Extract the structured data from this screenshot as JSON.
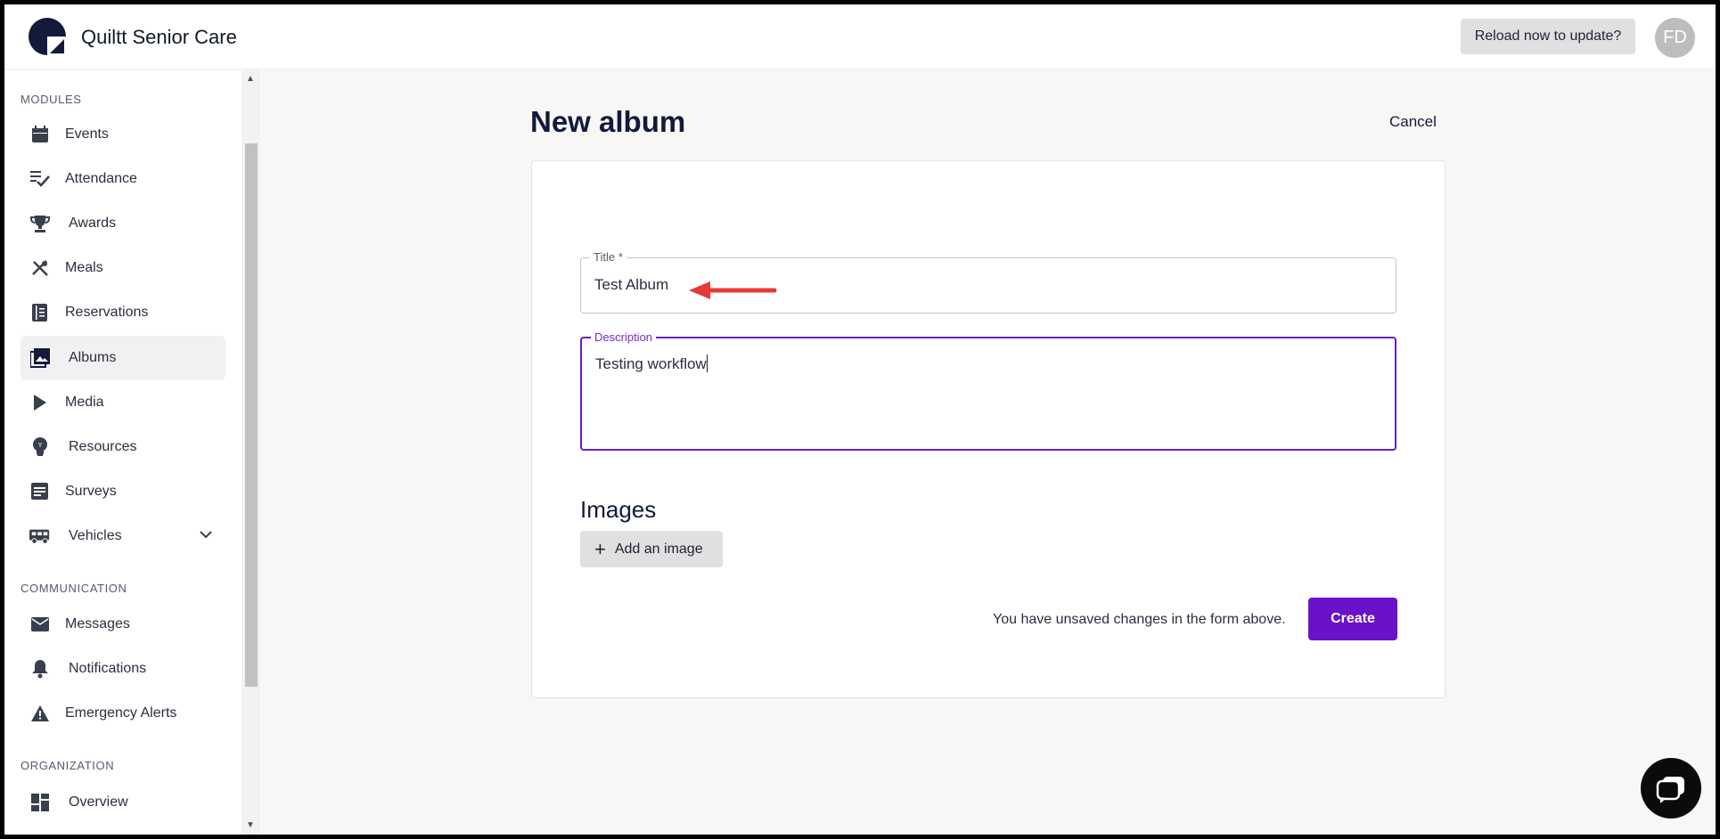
{
  "header": {
    "app_name": "Quiltt Senior Care",
    "reload_label": "Reload now to update?",
    "avatar_initials": "FD"
  },
  "sidebar": {
    "sections": {
      "modules": "MODULES",
      "communication": "COMMUNICATION",
      "organization": "ORGANIZATION"
    },
    "items": [
      {
        "label": "Events",
        "icon": "calendar-icon"
      },
      {
        "label": "Attendance",
        "icon": "checklist-icon"
      },
      {
        "label": "Awards",
        "icon": "trophy-icon"
      },
      {
        "label": "Meals",
        "icon": "utensils-icon"
      },
      {
        "label": "Reservations",
        "icon": "book-icon"
      },
      {
        "label": "Albums",
        "icon": "photo-album-icon",
        "active": true
      },
      {
        "label": "Media",
        "icon": "play-icon"
      },
      {
        "label": "Resources",
        "icon": "lightbulb-icon"
      },
      {
        "label": "Surveys",
        "icon": "survey-icon"
      },
      {
        "label": "Vehicles",
        "icon": "bus-icon",
        "expandable": true
      },
      {
        "label": "Messages",
        "icon": "envelope-icon"
      },
      {
        "label": "Notifications",
        "icon": "bell-icon"
      },
      {
        "label": "Emergency Alerts",
        "icon": "warning-icon"
      },
      {
        "label": "Overview",
        "icon": "dashboard-icon"
      }
    ]
  },
  "main": {
    "page_title": "New album",
    "cancel_label": "Cancel",
    "form": {
      "title_label": "Title *",
      "title_value": "Test Album",
      "description_label": "Description",
      "description_value": "Testing workflow",
      "images_heading": "Images",
      "add_image_label": "Add an image",
      "unsaved_notice": "You have unsaved changes in the form above.",
      "create_label": "Create"
    }
  },
  "colors": {
    "accent": "#6a12c9",
    "focus_border": "#6a1fbf",
    "annotation_arrow": "#e53935",
    "title_text": "#131a3a"
  }
}
